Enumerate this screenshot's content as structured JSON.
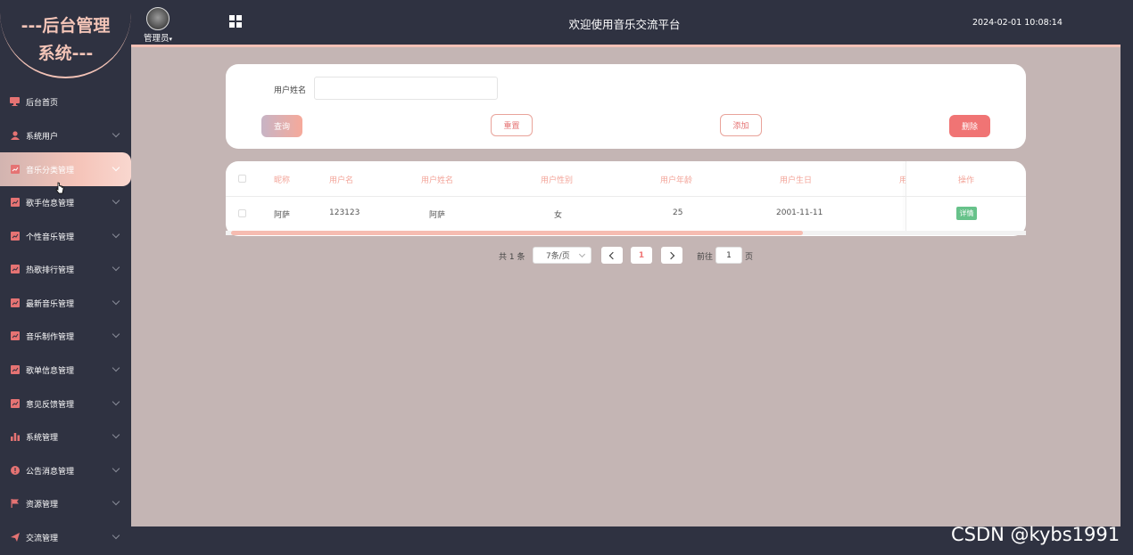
{
  "sidebar": {
    "logo": "---后台管理系统---",
    "logo_line1": "---后台管理",
    "logo_line2": "系统---",
    "items": [
      {
        "label": "后台首页",
        "icon": "monitor-icon",
        "has_children": false
      },
      {
        "label": "系统用户",
        "icon": "user-icon",
        "has_children": true
      },
      {
        "label": "音乐分类管理",
        "icon": "chart-icon",
        "has_children": true,
        "active": true
      },
      {
        "label": "歌手信息管理",
        "icon": "chart-icon",
        "has_children": true
      },
      {
        "label": "个性音乐管理",
        "icon": "chart-icon",
        "has_children": true
      },
      {
        "label": "热歌排行管理",
        "icon": "chart-icon",
        "has_children": true
      },
      {
        "label": "最新音乐管理",
        "icon": "chart-icon",
        "has_children": true
      },
      {
        "label": "音乐制作管理",
        "icon": "chart-icon",
        "has_children": true
      },
      {
        "label": "歌单信息管理",
        "icon": "chart-icon",
        "has_children": true
      },
      {
        "label": "意见反馈管理",
        "icon": "chart-icon",
        "has_children": true
      },
      {
        "label": "系统管理",
        "icon": "bar-chart-icon",
        "has_children": true
      },
      {
        "label": "公告消息管理",
        "icon": "alert-icon",
        "has_children": true
      },
      {
        "label": "资源管理",
        "icon": "flag-icon",
        "has_children": true
      },
      {
        "label": "交流管理",
        "icon": "send-icon",
        "has_children": true
      }
    ]
  },
  "header": {
    "user": "管理员",
    "title": "欢迎使用音乐交流平台",
    "datetime": "2024-02-01 10:08:14"
  },
  "search": {
    "label": "用户姓名",
    "value": "",
    "buttons": {
      "search": "查询",
      "reset": "重置",
      "add": "添加",
      "delete": "删除"
    }
  },
  "table": {
    "columns": [
      "昵称",
      "用户名",
      "用户姓名",
      "用户性别",
      "用户年龄",
      "用户生日",
      "用",
      "操作"
    ],
    "rows": [
      {
        "nickname": "阿萨",
        "username": "123123",
        "realname": "阿萨",
        "gender": "女",
        "age": "25",
        "birthday": "2001-11-11",
        "action": "详情"
      }
    ]
  },
  "pagination": {
    "total": "共 1 条",
    "page_size": "7条/页",
    "current": "1",
    "goto_label": "前往",
    "goto_value": "1",
    "page_unit": "页"
  },
  "watermark": "CSDN @kybs1991",
  "colors": {
    "accent": "#f07474",
    "header_bg": "#2f3241",
    "main_bg": "#c4b5b4",
    "pink": "#f4c1b6",
    "success": "#67c28a"
  }
}
